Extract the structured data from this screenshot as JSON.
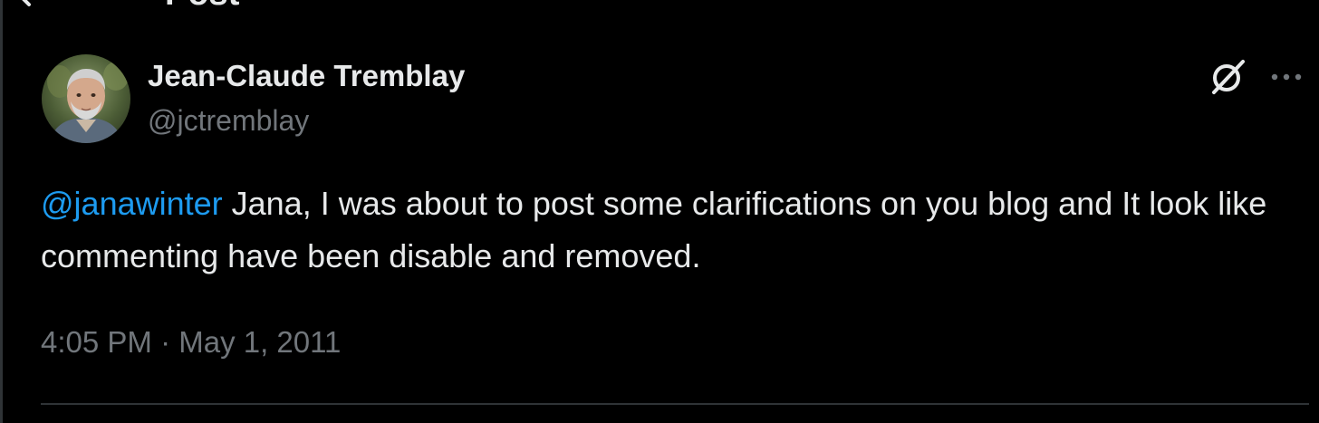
{
  "header": {
    "title": "Post"
  },
  "author": {
    "display_name": "Jean-Claude Tremblay",
    "handle": "@jctremblay"
  },
  "tweet": {
    "mention": "@janawinter",
    "text": " Jana, I was about to post some clarifications on you blog and It look like commenting have been disable and removed."
  },
  "meta": {
    "timestamp": "4:05 PM · May 1, 2011"
  },
  "icons": {
    "back": "back-arrow-icon",
    "grok": "grok-icon",
    "more": "more-icon"
  },
  "colors": {
    "background": "#000000",
    "text": "#e7e9ea",
    "secondary": "#71767b",
    "accent": "#1d9bf0",
    "divider": "#2f3336"
  }
}
